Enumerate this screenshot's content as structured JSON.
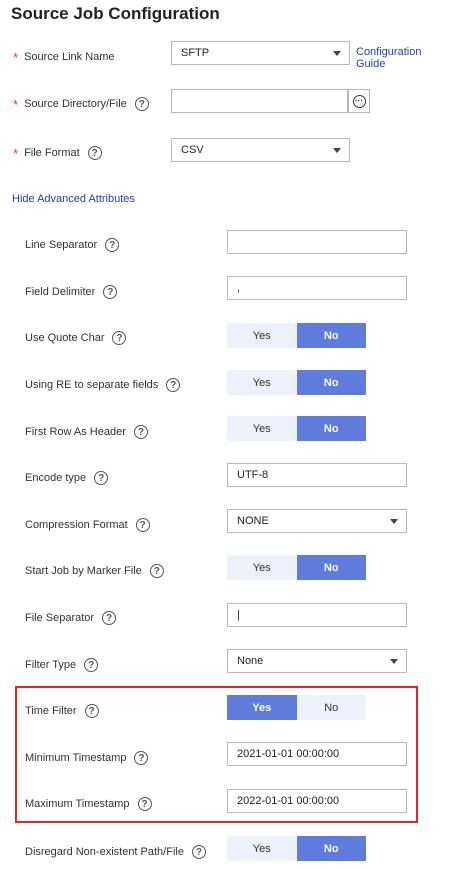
{
  "page": {
    "title": "Source Job Configuration"
  },
  "source_link": {
    "label": "Source Link Name",
    "value": "SFTP",
    "guide_link": "Configuration Guide"
  },
  "source_dir": {
    "label": "Source Directory/File",
    "value": ""
  },
  "file_format": {
    "label": "File Format",
    "value": "CSV"
  },
  "advanced_toggle": "Hide Advanced Attributes",
  "fields": {
    "line_separator": {
      "label": "Line Separator",
      "value": ""
    },
    "field_delimiter": {
      "label": "Field Delimiter",
      "value": ","
    },
    "use_quote_char": {
      "label": "Use Quote Char",
      "yes": "Yes",
      "no": "No",
      "selected": "No"
    },
    "using_re": {
      "label": "Using RE to separate fields",
      "yes": "Yes",
      "no": "No",
      "selected": "No"
    },
    "first_row_header": {
      "label": "First Row As Header",
      "yes": "Yes",
      "no": "No",
      "selected": "No"
    },
    "encode_type": {
      "label": "Encode type",
      "value": "UTF-8"
    },
    "compression_format": {
      "label": "Compression Format",
      "value": "NONE"
    },
    "start_by_marker": {
      "label": "Start Job by Marker File",
      "yes": "Yes",
      "no": "No",
      "selected": "No"
    },
    "file_separator": {
      "label": "File Separator",
      "value": "|"
    },
    "filter_type": {
      "label": "Filter Type",
      "value": "None"
    },
    "time_filter": {
      "label": "Time Filter",
      "yes": "Yes",
      "no": "No",
      "selected": "Yes"
    },
    "min_timestamp": {
      "label": "Minimum Timestamp",
      "value": "2021-01-01 00:00:00"
    },
    "max_timestamp": {
      "label": "Maximum Timestamp",
      "value": "2022-01-01 00:00:00"
    },
    "disregard_nonexistent": {
      "label": "Disregard Non-existent Path/File",
      "yes": "Yes",
      "no": "No",
      "selected": "No"
    }
  },
  "help_glyph": "?",
  "required_mark": "*",
  "browse_glyph": "···",
  "colors": {
    "accent": "#5f7cdc",
    "toggle_off": "#edf1f9",
    "required": "#e5383b",
    "link": "#1f3fb8",
    "highlight": "#e0262b"
  }
}
